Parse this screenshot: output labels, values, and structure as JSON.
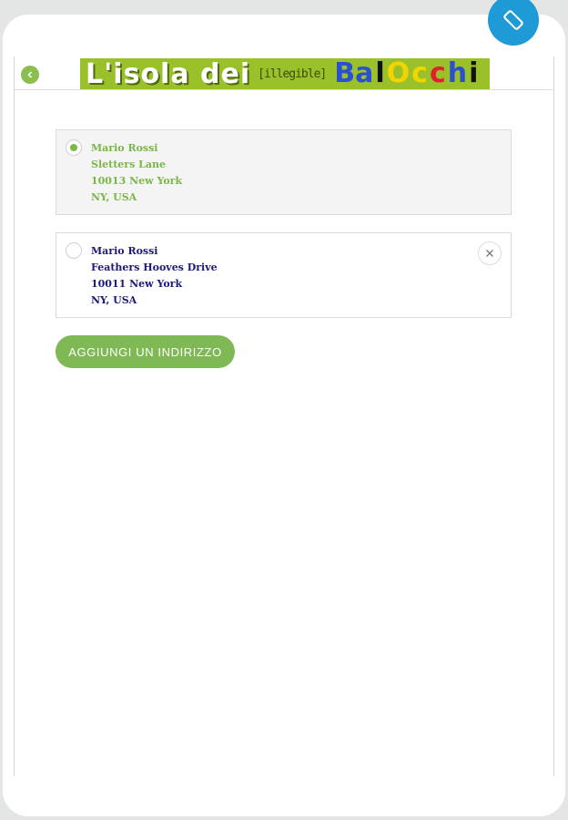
{
  "logo": {
    "main": "L'isola dei",
    "mid": "[illegible]",
    "tail": [
      "Ba",
      "l",
      "O",
      "c",
      "c",
      "h",
      "i"
    ],
    "tail_colors": [
      "#2a4fd1",
      "#111111",
      "#f2d400",
      "#f2d400",
      "#e0202a",
      "#2a4fd1",
      "#111111"
    ]
  },
  "addresses": [
    {
      "name": "Mario Rossi",
      "street": "Sletters Lane",
      "city": "10013 New York",
      "region": "NY, USA",
      "selected": true
    },
    {
      "name": "Mario Rossi",
      "street": "Feathers Hooves Drive",
      "city": "10011 New York",
      "region": "NY, USA",
      "selected": false
    }
  ],
  "add_button_label": "AGGIUNGI UN INDIRIZZO",
  "icons": {
    "rotate": "screen-rotation-icon",
    "back": "chevron-left-icon",
    "remove": "close-icon"
  },
  "colors": {
    "accent_green": "#7fb955",
    "rotate_blue": "#1e9ad6",
    "selected_text": "#7ab648",
    "default_text": "#1c1a7a"
  }
}
